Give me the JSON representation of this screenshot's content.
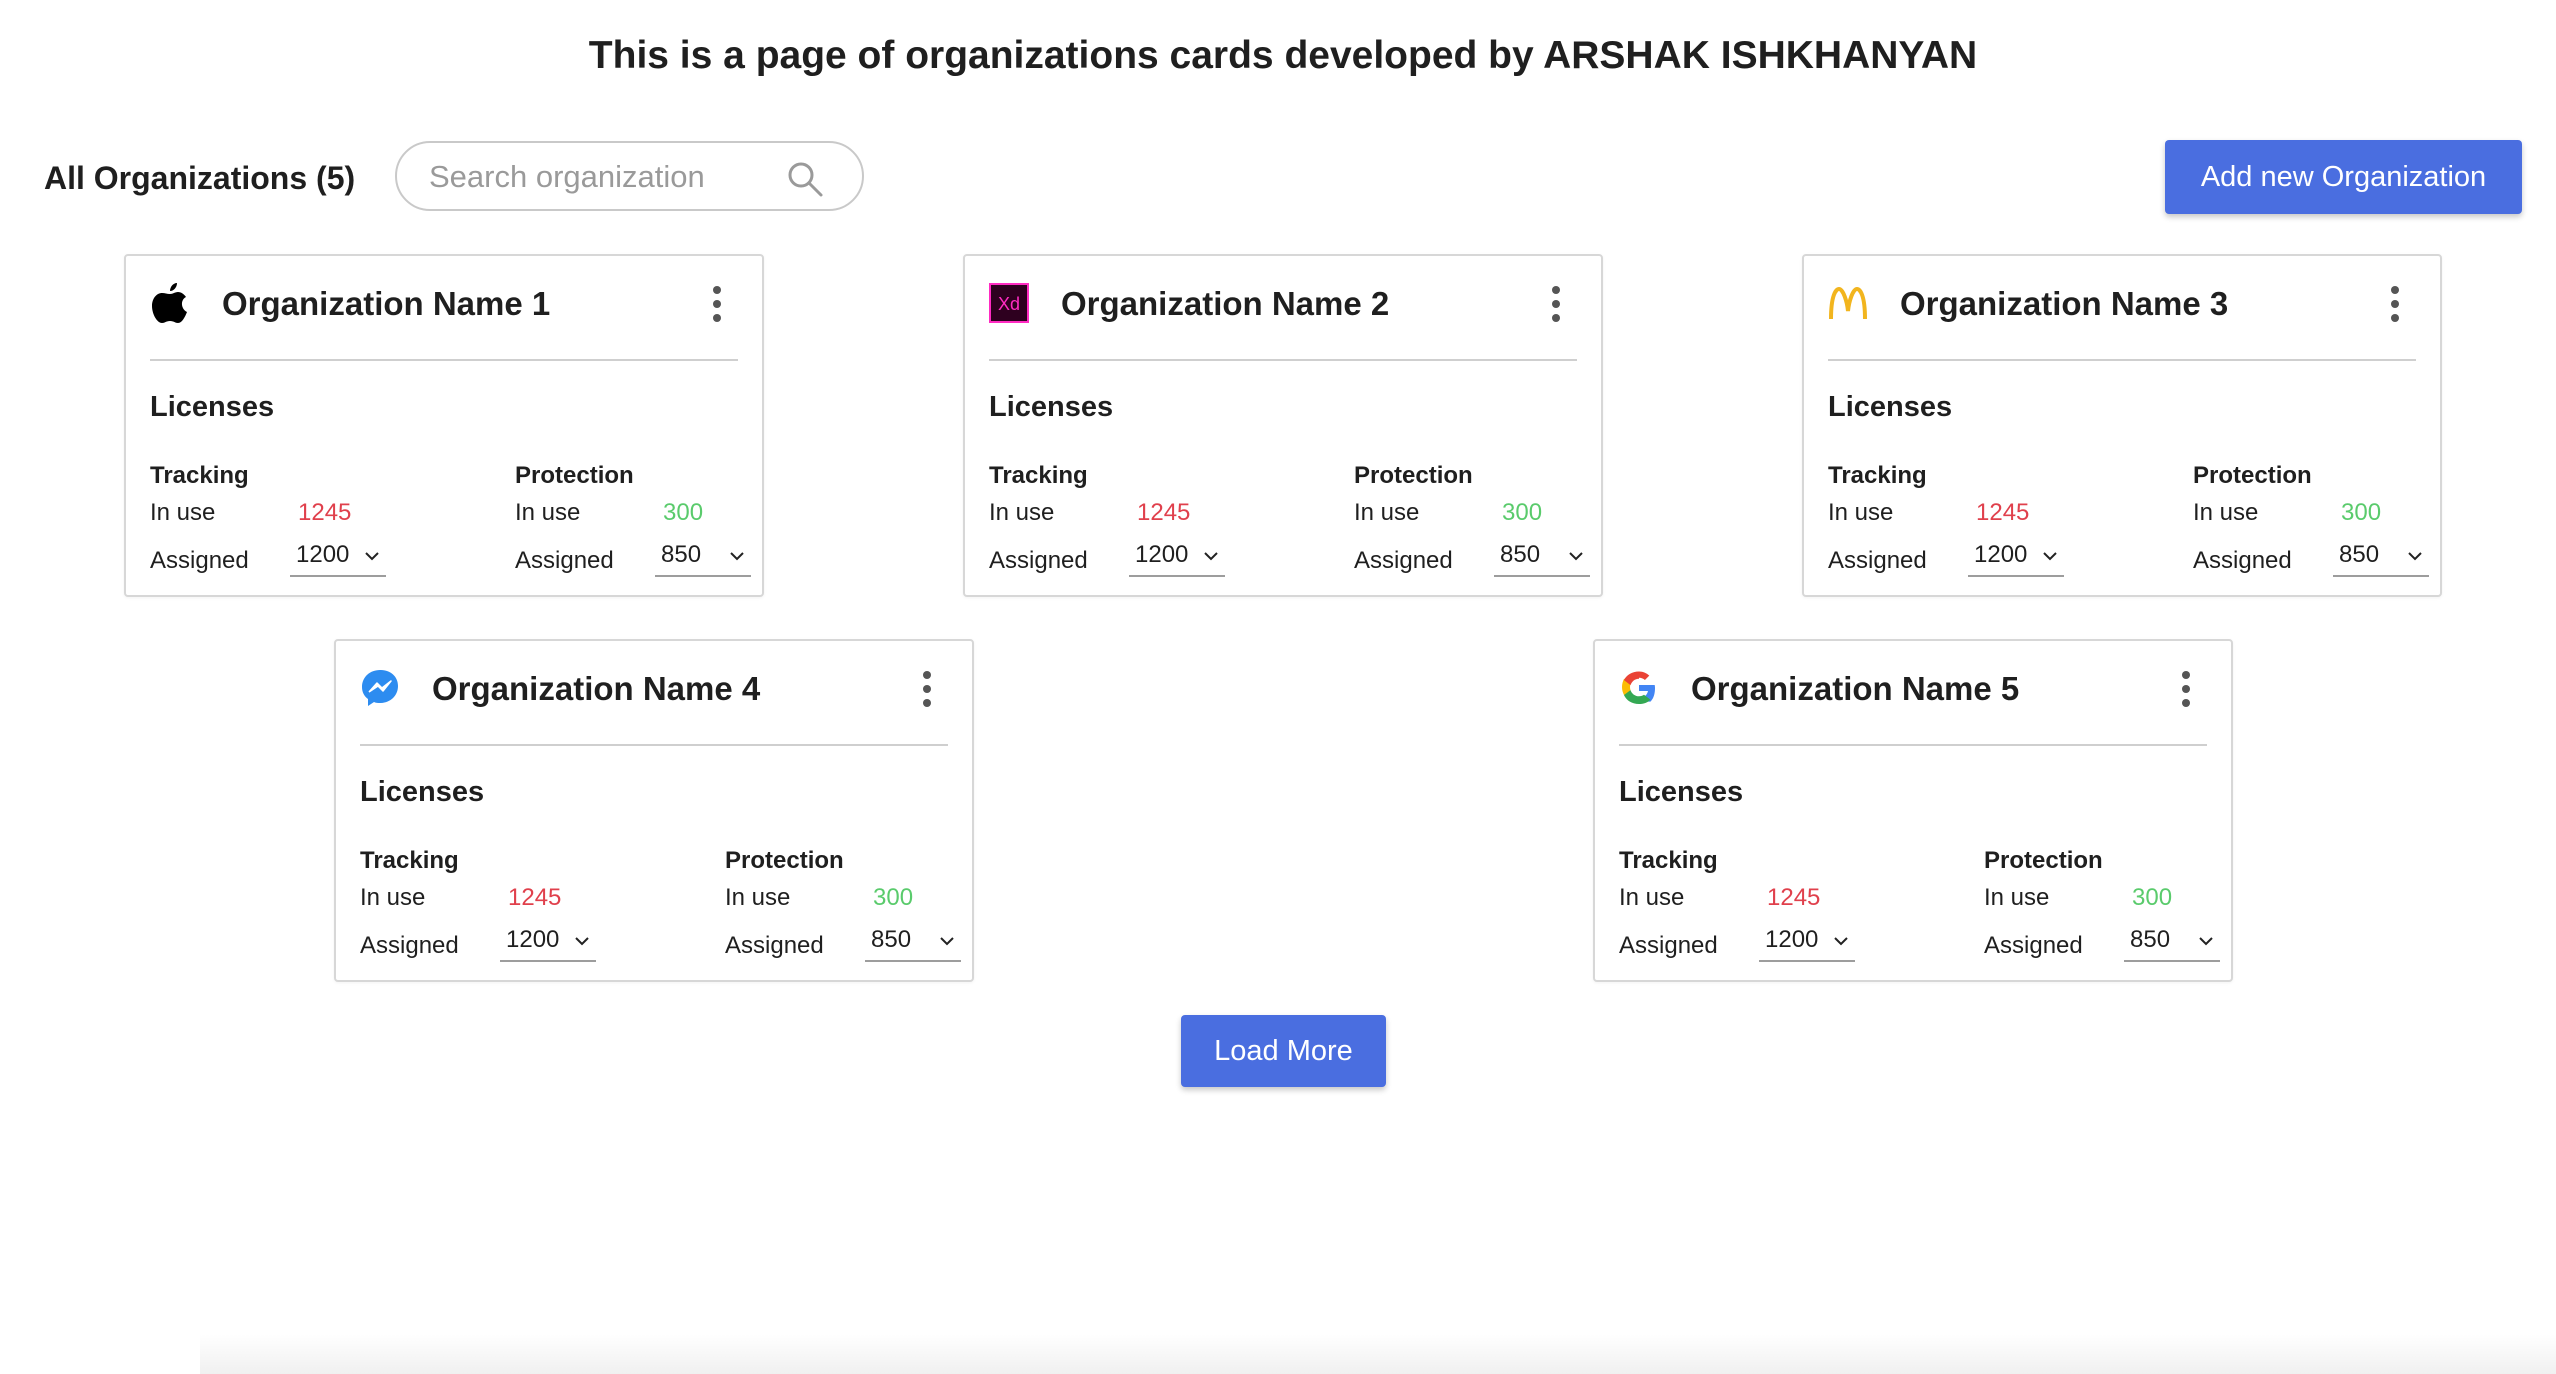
{
  "page": {
    "title": "This is a page of organizations cards developed by ARSHAK ISHKHANYAN"
  },
  "toolbar": {
    "title": "All Organizations (5)",
    "search_placeholder": "Search organization",
    "add_button": "Add new Organization"
  },
  "colors": {
    "accent": "#4a6ee0",
    "in_use_tracking": "#e0404c",
    "in_use_protection": "#5acb6c"
  },
  "organizations": [
    {
      "name": "Organization Name 1",
      "logo": "apple-logo-icon",
      "licenses_label": "Licenses",
      "tracking": {
        "label": "Tracking",
        "in_use_label": "In use",
        "in_use": "1245",
        "assigned_label": "Assigned",
        "assigned": "1200"
      },
      "protection": {
        "label": "Protection",
        "in_use_label": "In use",
        "in_use": "300",
        "assigned_label": "Assigned",
        "assigned": "850"
      }
    },
    {
      "name": "Organization Name 2",
      "logo": "adobe-xd-logo-icon",
      "logo_text": "Xd",
      "licenses_label": "Licenses",
      "tracking": {
        "label": "Tracking",
        "in_use_label": "In use",
        "in_use": "1245",
        "assigned_label": "Assigned",
        "assigned": "1200"
      },
      "protection": {
        "label": "Protection",
        "in_use_label": "In use",
        "in_use": "300",
        "assigned_label": "Assigned",
        "assigned": "850"
      }
    },
    {
      "name": "Organization Name 3",
      "logo": "mcdonalds-logo-icon",
      "licenses_label": "Licenses",
      "tracking": {
        "label": "Tracking",
        "in_use_label": "In use",
        "in_use": "1245",
        "assigned_label": "Assigned",
        "assigned": "1200"
      },
      "protection": {
        "label": "Protection",
        "in_use_label": "In use",
        "in_use": "300",
        "assigned_label": "Assigned",
        "assigned": "850"
      }
    },
    {
      "name": "Organization Name 4",
      "logo": "messenger-logo-icon",
      "licenses_label": "Licenses",
      "tracking": {
        "label": "Tracking",
        "in_use_label": "In use",
        "in_use": "1245",
        "assigned_label": "Assigned",
        "assigned": "1200"
      },
      "protection": {
        "label": "Protection",
        "in_use_label": "In use",
        "in_use": "300",
        "assigned_label": "Assigned",
        "assigned": "850"
      }
    },
    {
      "name": "Organization Name 5",
      "logo": "google-logo-icon",
      "licenses_label": "Licenses",
      "tracking": {
        "label": "Tracking",
        "in_use_label": "In use",
        "in_use": "1245",
        "assigned_label": "Assigned",
        "assigned": "1200"
      },
      "protection": {
        "label": "Protection",
        "in_use_label": "In use",
        "in_use": "300",
        "assigned_label": "Assigned",
        "assigned": "850"
      }
    }
  ],
  "load_more": "Load More"
}
